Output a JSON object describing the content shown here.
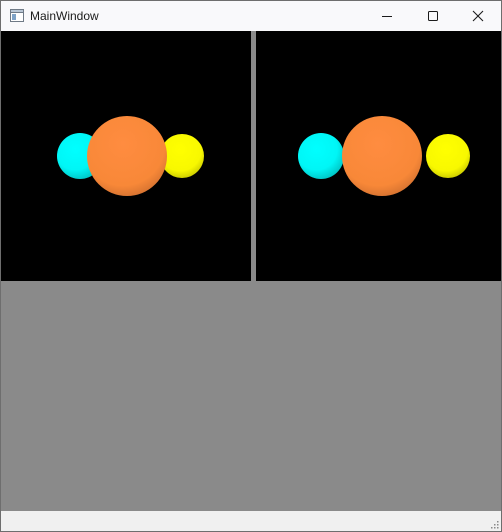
{
  "window": {
    "title": "MainWindow",
    "app_icon": "window-app-icon",
    "controls": {
      "minimize_icon": "minimize-icon",
      "maximize_icon": "maximize-icon",
      "close_icon": "close-icon"
    }
  },
  "viewports": [
    {
      "name": "left-3d-view",
      "background": "#000000",
      "spheres": [
        {
          "name": "cyan-sphere",
          "color": "#00ffff"
        },
        {
          "name": "orange-sphere",
          "color": "#ff8c40"
        },
        {
          "name": "yellow-sphere",
          "color": "#ffff00"
        }
      ]
    },
    {
      "name": "right-3d-view",
      "background": "#000000",
      "spheres": [
        {
          "name": "cyan-sphere",
          "color": "#00ffff"
        },
        {
          "name": "orange-sphere",
          "color": "#ff8c40"
        },
        {
          "name": "yellow-sphere",
          "color": "#ffff00"
        }
      ]
    }
  ],
  "colors": {
    "panel_gray": "#8a8a8a",
    "titlebar": "#f9f9fb"
  },
  "statusbar": {
    "size_grip_icon": "size-grip-icon"
  }
}
